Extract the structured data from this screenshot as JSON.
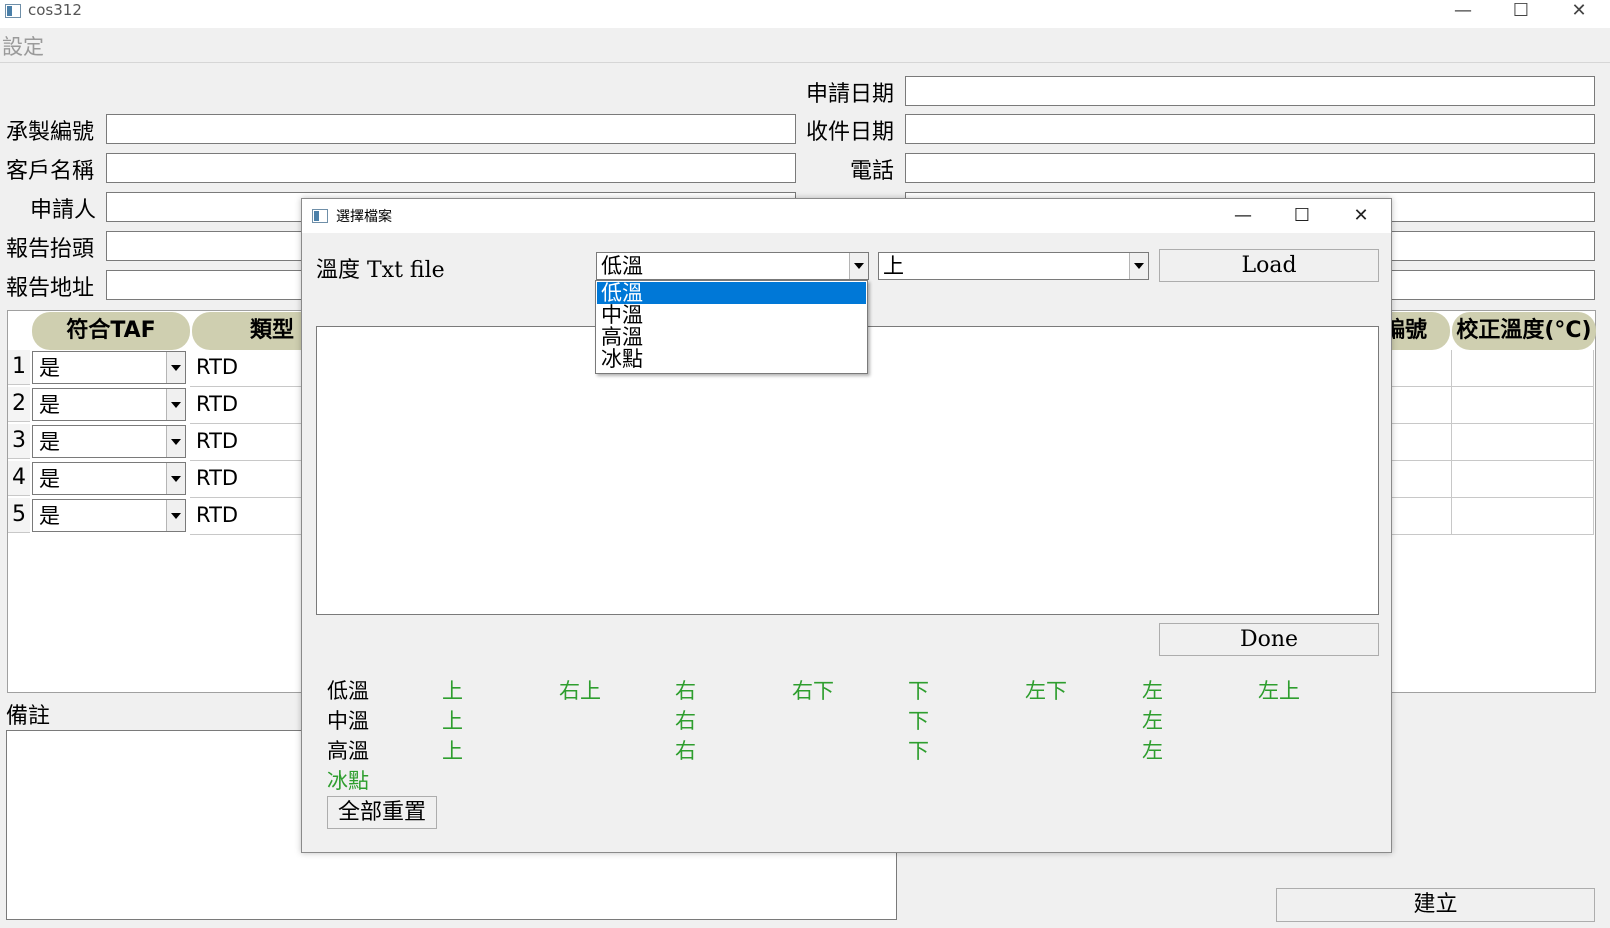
{
  "window": {
    "title": "cos312",
    "minimize": "—",
    "maximize": "☐",
    "close": "✕"
  },
  "menu": {
    "settings": "設定"
  },
  "form": {
    "apply_date": "申請日期",
    "order_no": "承製編號",
    "receive_date": "收件日期",
    "customer_name": "客戶名稱",
    "phone": "電話",
    "applicant": "申請人",
    "report_header": "報告抬頭",
    "report_address": "報告地址"
  },
  "table": {
    "headers": {
      "taf": "符合TAF",
      "type": "類型",
      "serial_partial": "編號",
      "cal_temp": "校正溫度(°C)"
    },
    "rows": [
      {
        "num": "1",
        "taf": "是",
        "type": "RTD"
      },
      {
        "num": "2",
        "taf": "是",
        "type": "RTD"
      },
      {
        "num": "3",
        "taf": "是",
        "type": "RTD"
      },
      {
        "num": "4",
        "taf": "是",
        "type": "RTD"
      },
      {
        "num": "5",
        "taf": "是",
        "type": "RTD"
      }
    ]
  },
  "remarks_label": "備註",
  "create_button": "建立",
  "dialog": {
    "title": "選擇檔案",
    "minimize": "—",
    "maximize": "☐",
    "close": "✕",
    "temp_label": "溫度 Txt file",
    "temp_combo_value": "低溫",
    "pos_combo_value": "上",
    "load_button": "Load",
    "done_button": "Done",
    "reset_button": "全部重置",
    "dropdown_options": [
      "低溫",
      "中溫",
      "高溫",
      "冰點"
    ],
    "status": {
      "low": {
        "label": "低溫",
        "items": [
          "上",
          "右上",
          "右",
          "右下",
          "下",
          "左下",
          "左",
          "左上"
        ]
      },
      "mid": {
        "label": "中溫",
        "items": [
          "上",
          "右",
          "下",
          "左"
        ]
      },
      "high": {
        "label": "高溫",
        "items": [
          "上",
          "右",
          "下",
          "左"
        ]
      },
      "ice": {
        "label": "冰點"
      }
    },
    "colors": {
      "done": "#2e9e2e",
      "selected": "#0078d7"
    }
  }
}
